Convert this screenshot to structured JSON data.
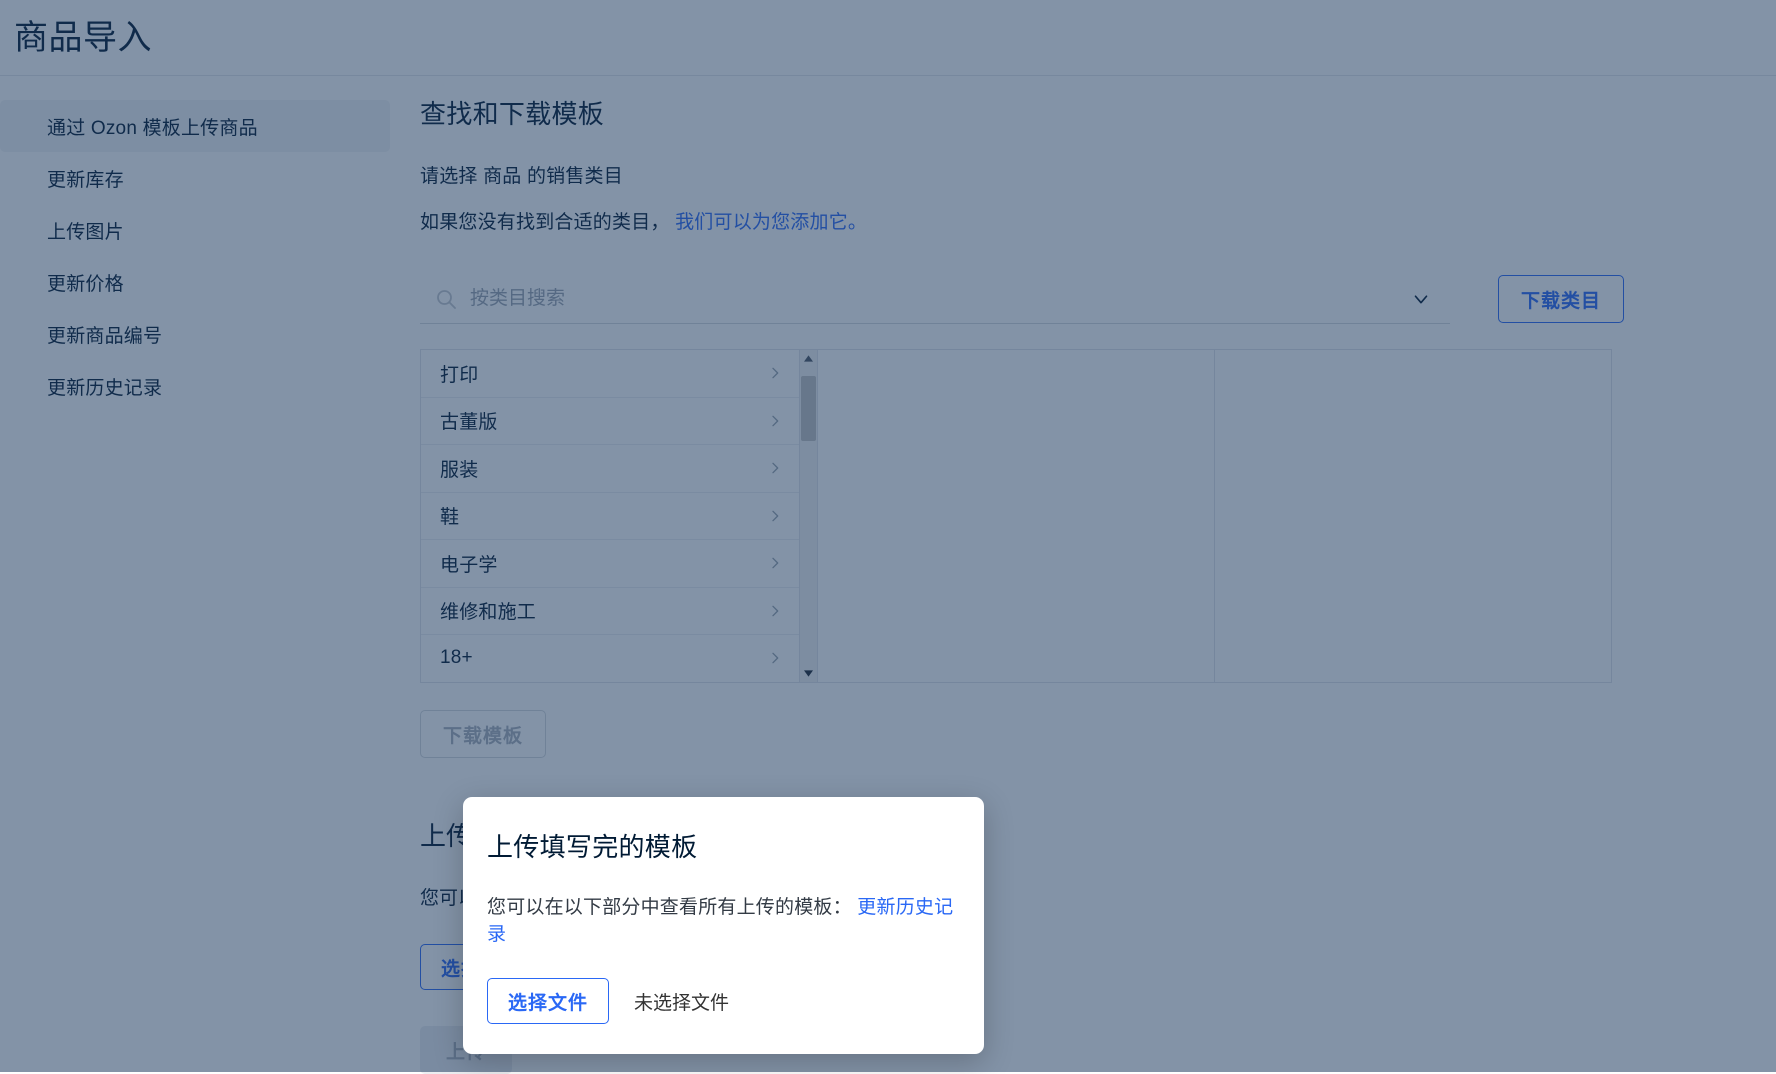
{
  "header": {
    "title": "商品导入"
  },
  "sidebar": {
    "items": [
      {
        "label": "通过 Ozon 模板上传商品",
        "active": true
      },
      {
        "label": "更新库存",
        "active": false
      },
      {
        "label": "上传图片",
        "active": false
      },
      {
        "label": "更新价格",
        "active": false
      },
      {
        "label": "更新商品编号",
        "active": false
      },
      {
        "label": "更新历史记录",
        "active": false
      }
    ]
  },
  "main": {
    "title": "查找和下载模板",
    "subtitle": "请选择 商品 的销售类目",
    "help_prefix": "如果您没有找到合适的类目，",
    "help_link": "我们可以为您添加它。",
    "search": {
      "placeholder": "按类目搜索",
      "value": "",
      "icon": "search-icon",
      "chevron": "chevron-down-icon"
    },
    "download_category_button": "下载类目",
    "categories": [
      "打印",
      "古董版",
      "服装",
      "鞋",
      "电子学",
      "维修和施工",
      "18+"
    ],
    "download_template_button": "下载模板",
    "upload_section": {
      "title": "上传填写完的模板",
      "desc_prefix": "您可以在以下部分中查看所有上传的模板：",
      "desc_link": "更新历史记录",
      "choose_file_button": "选择文件",
      "file_status": "未选择文件",
      "upload_button": "上传"
    }
  },
  "modal": {
    "title": "上传填写完的模板",
    "desc_prefix": "您可以在以下部分中查看所有上传的模板：",
    "desc_link": "更新历史记录",
    "choose_file_button": "选择文件",
    "file_status": "未选择文件"
  },
  "colors": {
    "accent_blue": "#2a68f5",
    "text_primary": "#001a34",
    "overlay": "#677688",
    "sidebar_active_bg": "#f2f3f5",
    "border": "#e0e3e8"
  }
}
